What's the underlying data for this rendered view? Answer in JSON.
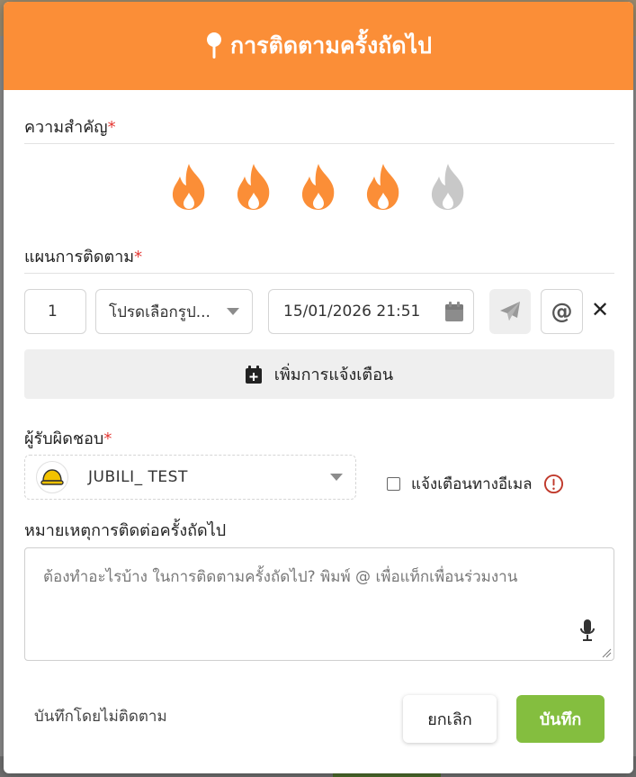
{
  "header": {
    "title": "การติดตามครั้งถัดไป",
    "icon": "pushpin-icon"
  },
  "priority": {
    "label": "ความสำคัญ",
    "required_mark": "*",
    "flames": [
      {
        "icon": "flame-icon",
        "active": true
      },
      {
        "icon": "flame-icon",
        "active": true
      },
      {
        "icon": "flame-icon",
        "active": true
      },
      {
        "icon": "flame-icon",
        "active": true
      },
      {
        "icon": "flame-icon",
        "active": false
      }
    ],
    "active_color": "#fb8e37",
    "inactive_color": "#c8c8c8"
  },
  "plan": {
    "label": "แผนการติดตาม",
    "required_mark": "*",
    "number": "1",
    "type_select": "โปรดเลือกรูป...",
    "datetime": "15/01/2026 21:51",
    "add_alert_label": "เพิ่มการแจ้งเตือน"
  },
  "owner": {
    "label": "ผู้รับผิดชอบ",
    "required_mark": "*",
    "name": "JUBILI_ TEST",
    "email_notify_label": "แจ้งเตือนทางอีเมล"
  },
  "note": {
    "label": "หมายเหตุการติดต่อครั้งถัดไป",
    "placeholder": "ต้องทำอะไรบ้าง ในการติดตามครั้งถัดไป? พิมพ์ @ เพื่อแท็กเพื่อนร่วมงาน"
  },
  "footer": {
    "skip_label": "บันทึกโดยไม่ติดตาม",
    "cancel_label": "ยกเลิก",
    "save_label": "บันทึก"
  },
  "colors": {
    "header": "#fb8e37",
    "save": "#84be3f",
    "required": "#e53935",
    "warning": "#c0392b"
  }
}
